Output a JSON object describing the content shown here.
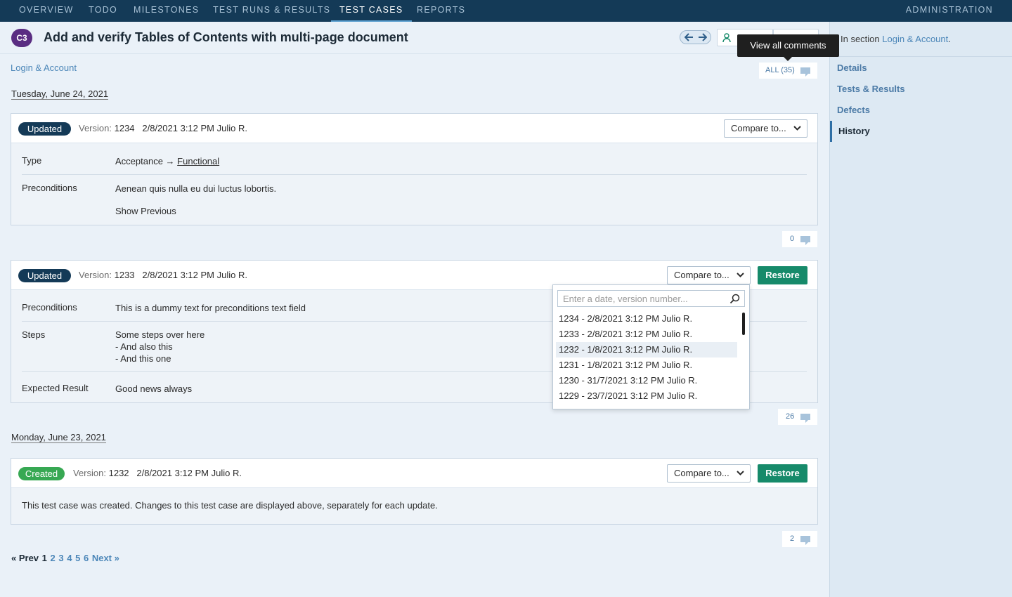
{
  "topnav": {
    "tabs": [
      "OVERVIEW",
      "TODO",
      "MILESTONES",
      "TEST RUNS & RESULTS",
      "TEST CASES",
      "REPORTS"
    ],
    "active": "TEST CASES",
    "admin": "ADMINISTRATION"
  },
  "header": {
    "case_id": "C3",
    "title": "Add and verify Tables of Contents with multi-page document",
    "tooltip": "View all comments"
  },
  "breadcrumb": "Login & Account",
  "all_comments": "ALL (35)",
  "sidebar": {
    "section_prefix": "In section",
    "section_link": "Login & Account",
    "section_suffix": ".",
    "items": [
      "Details",
      "Tests & Results",
      "Defects",
      "History"
    ],
    "active": "History"
  },
  "dates": [
    "Tuesday, June 24, 2021",
    "Monday, June 23, 2021"
  ],
  "labels": {
    "version": "Version:",
    "compare": "Compare to...",
    "restore": "Restore",
    "show_previous": "Show Previous"
  },
  "cards": [
    {
      "status": "Updated",
      "version": "1234",
      "meta": "2/8/2021 3:12 PM Julio R.",
      "rows": {
        "type_label": "Type",
        "type_from": "Acceptance →",
        "type_to": "Functional",
        "pre_label": "Preconditions",
        "pre_value": "Aenean quis nulla eu dui luctus lobortis."
      },
      "comments": "0"
    },
    {
      "status": "Updated",
      "version": "1233",
      "meta": "2/8/2021 3:12 PM Julio R.",
      "rows": {
        "pre_label": "Preconditions",
        "pre_value": "This is a dummy text for preconditions text field",
        "steps_label": "Steps",
        "steps_lines": [
          "Some steps over here",
          "- And also this",
          "- And this one"
        ],
        "exp_label": "Expected Result",
        "exp_value": "Good news always"
      },
      "comments": "26"
    },
    {
      "status": "Created",
      "version": "1232",
      "meta": "2/8/2021 3:12 PM Julio R.",
      "text": "This test case was created. Changes to this test case are displayed above, separately for each update.",
      "comments": "2"
    }
  ],
  "dropdown": {
    "placeholder": "Enter a date, version number...",
    "items": [
      "1234 - 2/8/2021 3:12 PM  Julio R.",
      "1233 - 2/8/2021 3:12 PM  Julio R.",
      "1232 - 1/8/2021 3:12 PM  Julio R.",
      "1231 - 1/8/2021 3:12 PM  Julio R.",
      "1230 - 31/7/2021 3:12 PM  Julio R.",
      "1229 - 23/7/2021 3:12 PM  Julio R."
    ],
    "highlighted": "1232 - 1/8/2021 3:12 PM  Julio R."
  },
  "pager": {
    "prev": "« Prev",
    "current": "1",
    "pages": [
      "2",
      "3",
      "4",
      "5",
      "6"
    ],
    "next": "Next »"
  },
  "colors": {
    "nav_bg": "#143a57",
    "updated": "#143a57",
    "created": "#37a853",
    "restore": "#168a6a",
    "link": "#4b86b8",
    "case_badge": "#5a2d82"
  }
}
